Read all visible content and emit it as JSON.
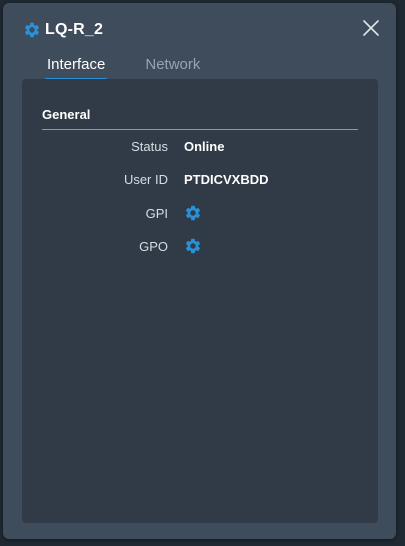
{
  "window": {
    "title": "LQ-R_2",
    "title_icon": "gear-icon",
    "close_icon": "close-icon"
  },
  "tabs": [
    {
      "label": "Interface",
      "active": true
    },
    {
      "label": "Network",
      "active": false
    }
  ],
  "general": {
    "title": "General",
    "rows": {
      "status": {
        "label": "Status",
        "value": "Online"
      },
      "user_id": {
        "label": "User ID",
        "value": "PTDICVXBDD"
      },
      "gpi": {
        "label": "GPI",
        "icon": "gear-icon"
      },
      "gpo": {
        "label": "GPO",
        "icon": "gear-icon"
      }
    }
  },
  "colors": {
    "accent": "#2a90d8",
    "panel_bg": "#3f4c5c",
    "content_bg": "#303b47"
  }
}
